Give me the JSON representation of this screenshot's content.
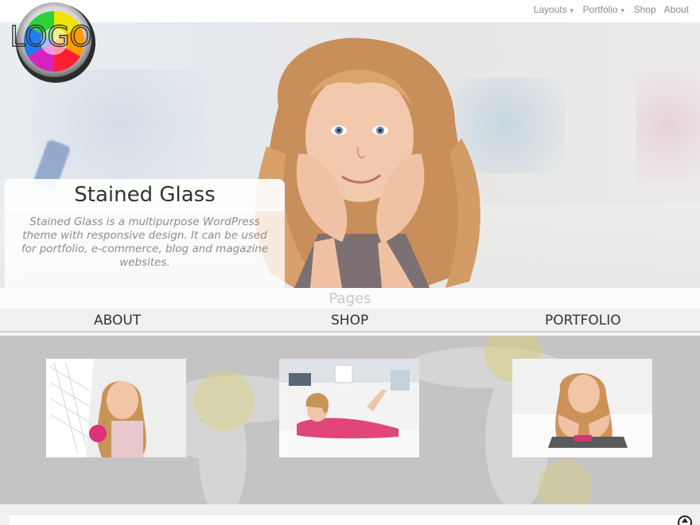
{
  "nav": {
    "items": [
      {
        "label": "Layouts",
        "has_dropdown": true
      },
      {
        "label": "Portfolio",
        "has_dropdown": true
      },
      {
        "label": "Shop",
        "has_dropdown": false
      },
      {
        "label": "About",
        "has_dropdown": false
      }
    ]
  },
  "logo": {
    "text": "LOGO"
  },
  "hero": {
    "title": "Stained Glass",
    "description": "Stained Glass is a multipurpose WordPress theme with responsive design. It can be used for portfolio, e-commerce, blog and magazine websites."
  },
  "pages": {
    "heading": "Pages",
    "links": [
      "ABOUT",
      "SHOP",
      "PORTFOLIO"
    ]
  },
  "gallery": {
    "thumbnails": [
      "girl-in-wicker-chair-with-pink-flower",
      "girl-lying-on-floor-in-pink-dress",
      "girl-lying-on-floor-chin-on-hands"
    ]
  },
  "colors": {
    "accent": "#333333",
    "nav_text": "#8a8a8a",
    "gallery_bg": "#c4c4c4"
  },
  "icons": {
    "dropdown": "chevron-down-icon",
    "scroll_top": "arrow-up-icon"
  }
}
